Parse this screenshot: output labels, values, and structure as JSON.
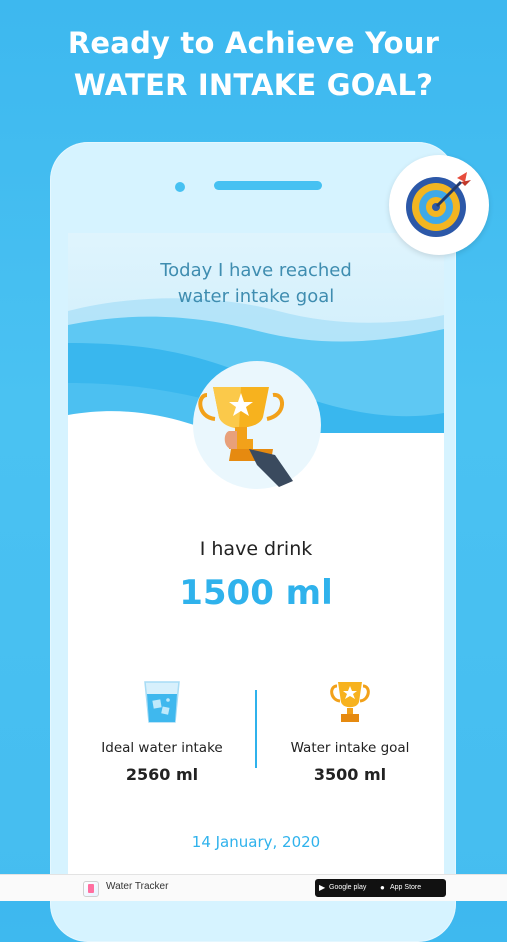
{
  "headline": {
    "line1": "Ready to Achieve Your",
    "line2": "WATER INTAKE GOAL?"
  },
  "screen": {
    "goal_message_line1": "Today I have reached",
    "goal_message_line2": "water intake goal",
    "drink_label": "I have drink",
    "drink_value": "1500 ml",
    "stats": [
      {
        "label": "Ideal water intake",
        "value": "2560 ml",
        "icon": "water-glass-icon"
      },
      {
        "label": "Water intake goal",
        "value": "3500 ml",
        "icon": "trophy-icon"
      }
    ],
    "date": "14 January, 2020"
  },
  "footer": {
    "app_name": "Water Tracker",
    "google_play": "Google play",
    "app_store": "App Store"
  },
  "colors": {
    "background": "#3db8ef",
    "accent": "#2fb2ec",
    "goal_text": "#3f8db0",
    "trophy_gold": "#f7b21e"
  }
}
